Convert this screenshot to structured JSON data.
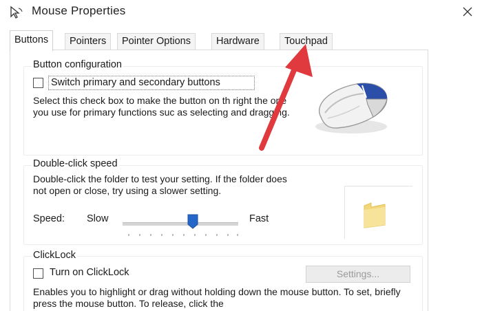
{
  "window": {
    "title": "Mouse Properties",
    "close_glyph": "✕"
  },
  "tabs": [
    {
      "label": "Buttons",
      "active": true
    },
    {
      "label": "Pointers",
      "active": false
    },
    {
      "label": "Pointer Options",
      "active": false
    },
    {
      "label": "Hardware",
      "active": false
    },
    {
      "label": "Touchpad",
      "active": false
    }
  ],
  "button_config": {
    "title": "Button configuration",
    "switch_label": "Switch primary and secondary buttons",
    "switch_checked": false,
    "description": "Select this check box to make the button on th right the one you use for primary functions suc as selecting and dragging."
  },
  "double_click": {
    "title": "Double-click speed",
    "description": "Double-click the folder to test your setting. If the folder does not open or close, try using a slower setting.",
    "speed_label": "Speed:",
    "slow_label": "Slow",
    "fast_label": "Fast",
    "speed_value": 0.55
  },
  "clicklock": {
    "title": "ClickLock",
    "turn_on_label": "Turn on ClickLock",
    "turn_on_checked": false,
    "settings_label": "Settings...",
    "description": "Enables you to highlight or drag without holding down the mouse button. To set, briefly press the mouse button. To release, click the"
  },
  "colors": {
    "annotation_arrow": "#e0393e",
    "mouse_accent": "#2b4fa8",
    "slider_thumb": "#2567c9",
    "folder": "#f2d679"
  },
  "icons": {
    "title": "mouse-pointer-icon",
    "close": "close-icon",
    "mouse_illustration": "mouse-illustration-icon",
    "folder": "folder-icon"
  }
}
